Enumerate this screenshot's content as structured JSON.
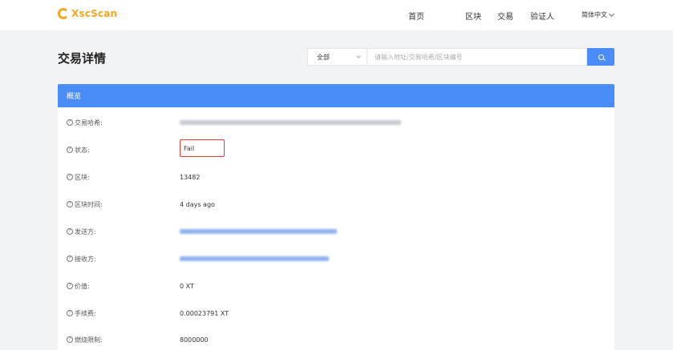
{
  "header": {
    "brand": "XscScan",
    "nav": [
      "首页",
      "区块",
      "交易",
      "验证人"
    ],
    "language": "简体中文"
  },
  "page_title": "交易详情",
  "search": {
    "filter_selected": "全部",
    "placeholder": "请输入地址/交易哈希/区块编号"
  },
  "card": {
    "title": "概览",
    "rows": [
      {
        "label": "交易哈希:",
        "value": ""
      },
      {
        "label": "状态:",
        "value": "Fail"
      },
      {
        "label": "区块:",
        "value": "13482"
      },
      {
        "label": "区块时间:",
        "value": "4 days ago"
      },
      {
        "label": "发送方:",
        "value": ""
      },
      {
        "label": "接收方:",
        "value": ""
      },
      {
        "label": "价值:",
        "value": "0 XT"
      },
      {
        "label": "手续费:",
        "value": "0.00023791 XT"
      },
      {
        "label": "燃烧限制:",
        "value": "8000000"
      }
    ]
  },
  "colors": {
    "accent": "#4b8df8",
    "brand": "#f5a623",
    "highlight": "#e53935"
  },
  "icons": [
    "xscscan-logo-icon",
    "chevron-down-icon",
    "search-icon",
    "help-circle-icon"
  ]
}
